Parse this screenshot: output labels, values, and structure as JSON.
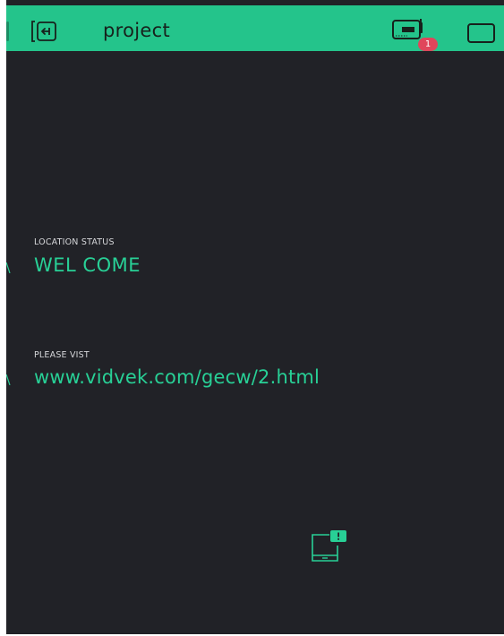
{
  "header": {
    "title": "project",
    "notification_count": "1"
  },
  "widgets": [
    {
      "label": "LOCATION STATUS",
      "value": "WEL COME"
    },
    {
      "label": "PLEASE VIST",
      "value": "www.vidvek.com/gecw/2.html"
    }
  ],
  "icons": {
    "back": "exit-app-icon",
    "device": "device-status-icon",
    "menu": "square-icon",
    "offline_device": "phone-notification-icon"
  },
  "colors": {
    "header_bg": "#24c48b",
    "screen_bg": "#212227",
    "accent": "#28d096",
    "badge": "#e0465b"
  }
}
